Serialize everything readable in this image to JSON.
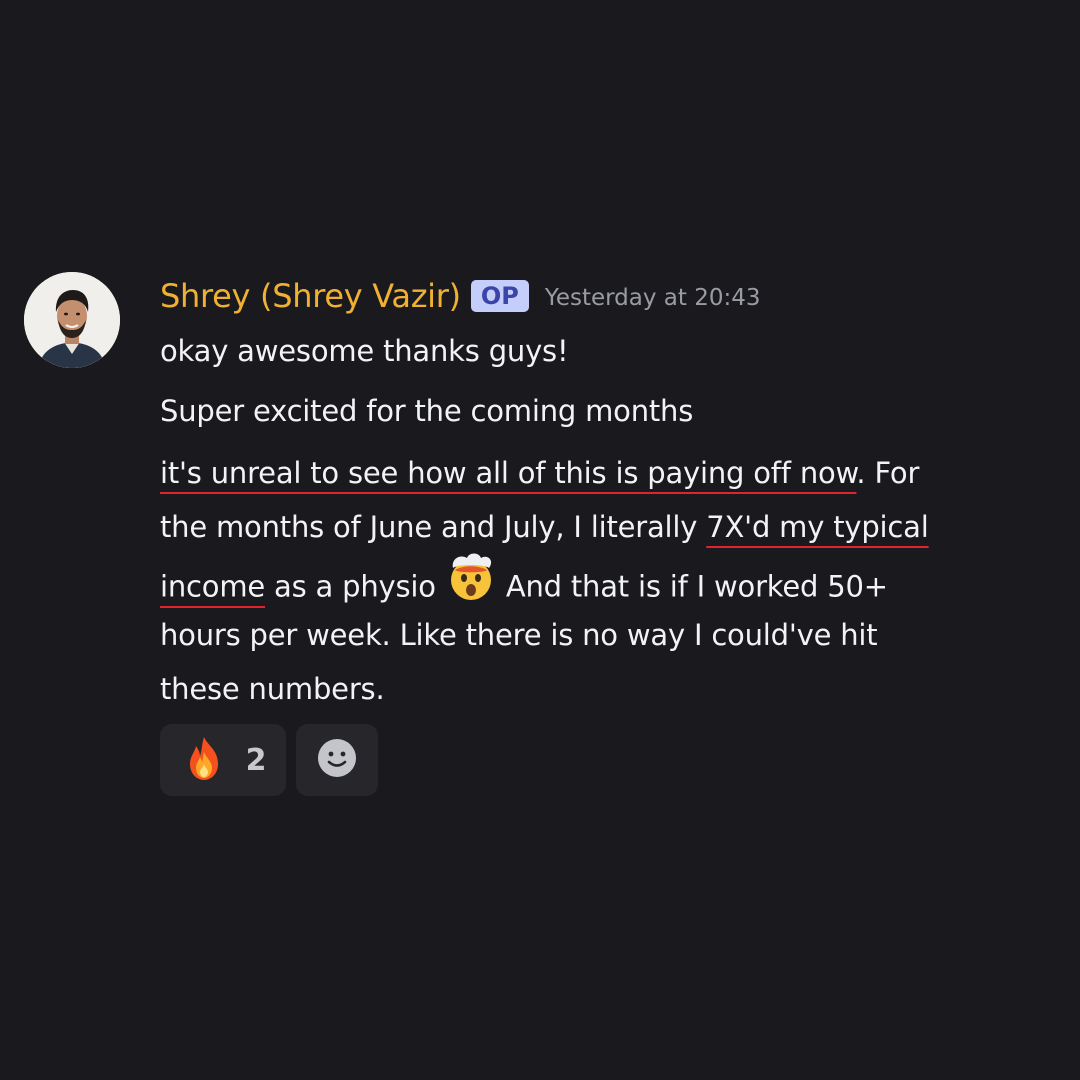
{
  "message": {
    "author": "Shrey (Shrey Vazir)",
    "badge": "OP",
    "timestamp": "Yesterday at 20:43",
    "lines": [
      "okay awesome thanks guys!",
      "Super excited for the coming months"
    ],
    "paragraph": {
      "l1_underlined": "it's unreal to see how all of this is paying off now",
      "l1_rest": ". For",
      "l2_plain": "the months of June and July, I literally ",
      "l2_underlined": "7X'd my typical",
      "l3_underlined": "income",
      "l3_mid": " as a physio ",
      "l3_emoji": "exploding-head-emoji",
      "l3_rest": " And that is if I worked 50+",
      "l4": "hours per week. Like there is no way I could've hit",
      "l5": "these numbers."
    },
    "colors": {
      "background": "#1a1a1e",
      "username": "#f0b132",
      "badge_bg": "#c5cdfb",
      "badge_text": "#3b45a8",
      "timestamp": "#9a9ca3",
      "underline": "#e0232e",
      "reaction_bg": "#26262b"
    }
  },
  "reactions": [
    {
      "emoji": "fire-emoji",
      "count": "2"
    },
    {
      "emoji": "add-reaction-icon"
    }
  ]
}
